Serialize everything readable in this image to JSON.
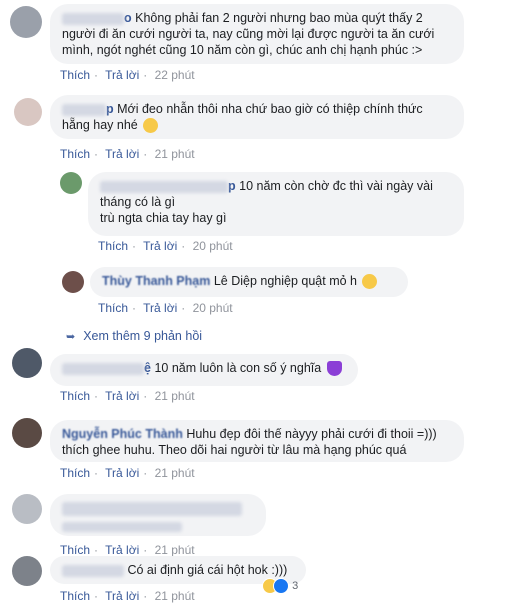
{
  "actions": {
    "like": "Thích",
    "reply": "Trả lời"
  },
  "comments": [
    {
      "author_visible": "o",
      "text_lines": [
        "Không phải fan 2 người nhưng bao mùa quýt thấy 2",
        "người đi ăn cưới người ta, nay cũng mời lại được người ta ăn cưới",
        "mình, ngót nghét cũng 10 năm còn gì, chúc anh chị hạnh phúc :>"
      ],
      "time": "22 phút"
    },
    {
      "author_visible": "p",
      "text_lines": [
        "Mới đeo nhẫn thôi nha chứ bao giờ có thiệp chính thức",
        "hẵng hay nhé"
      ],
      "time": "21 phút"
    },
    {
      "author_visible": "p",
      "text_lines": [
        "10 năm còn chờ đc thì vài ngày vài",
        "tháng có là gì",
        "trù ngta chia tay hay gì"
      ],
      "time": "20 phút"
    },
    {
      "author_visible": "Thùy Thanh Phạm",
      "text_lines": [
        "Lê Diệp nghiệp quật mỏ h"
      ],
      "time": "20 phút"
    },
    {
      "author_visible": "ệ",
      "text_lines": [
        "10 năm luôn là con số ý nghĩa"
      ],
      "time": "21 phút"
    },
    {
      "author_visible": "Nguyễn Phúc Thành",
      "text_lines": [
        "Huhu đẹp đôi thế nàyyy phải cưới đi thoii =)))",
        "thích ghee huhu. Theo dõi hai người từ lâu mà hạng phúc quá"
      ],
      "time": "21 phút"
    },
    {
      "author_visible": "",
      "text_lines": [
        ""
      ],
      "time": "21 phút"
    },
    {
      "author_visible": "",
      "text_lines": [
        "Có ai định giá cái hột hok :)))"
      ],
      "time": "21 phút"
    }
  ],
  "more_replies": "Xem thêm 9 phản hồi",
  "reaction_count": "3",
  "colors": {
    "link": "#385898",
    "bubble": "#f2f3f5",
    "meta": "#616770",
    "heart": "#8b3fd6"
  }
}
